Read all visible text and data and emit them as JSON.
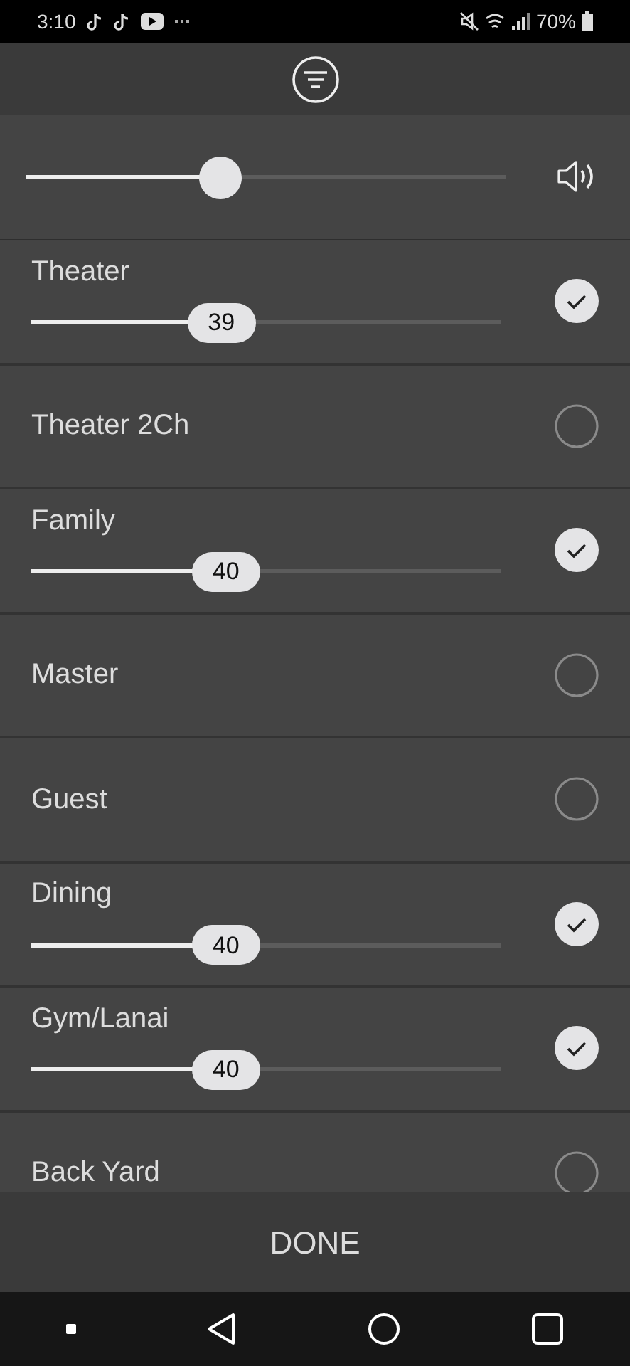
{
  "status_bar": {
    "time": "3:10",
    "battery": "70%"
  },
  "master_volume": {
    "level": 0.405
  },
  "zones": [
    {
      "name": "Theater",
      "checked": true,
      "level": 0.405,
      "reading": "39"
    },
    {
      "name": "Theater 2Ch",
      "checked": false
    },
    {
      "name": "Family",
      "checked": true,
      "level": 0.415,
      "reading": "40"
    },
    {
      "name": "Master",
      "checked": false
    },
    {
      "name": "Guest",
      "checked": false
    },
    {
      "name": "Dining",
      "checked": true,
      "level": 0.415,
      "reading": "40"
    },
    {
      "name": "Gym/Lanai",
      "checked": true,
      "level": 0.415,
      "reading": "40"
    },
    {
      "name": "Back Yard",
      "checked": false
    }
  ],
  "done_button": "DONE"
}
